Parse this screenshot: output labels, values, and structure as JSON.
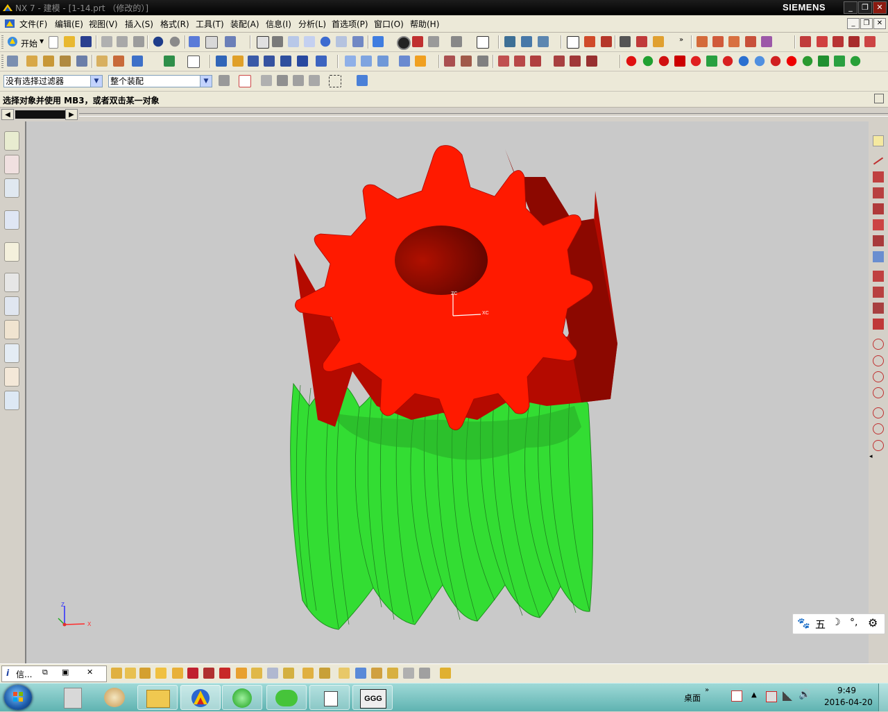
{
  "window": {
    "title": "NX 7 - 建模 - [1-14.prt （修改的）]",
    "brand": "SIEMENS",
    "controls": [
      "_",
      "❐",
      "✕"
    ]
  },
  "menu": {
    "items": [
      "文件(F)",
      "编辑(E)",
      "视图(V)",
      "插入(S)",
      "格式(R)",
      "工具(T)",
      "装配(A)",
      "信息(I)",
      "分析(L)",
      "首选项(P)",
      "窗口(O)",
      "帮助(H)"
    ]
  },
  "toolbar": {
    "start_label": "开始",
    "filter_value": "没有选择过滤器",
    "scope_value": "整个装配"
  },
  "cue_line": "选择对象并使用 MB3，或者双击某一对象",
  "viewport": {
    "wcs_z": "ZC",
    "wcs_x": "XC",
    "triad_z": "Z",
    "triad_x": "X",
    "gear_color": "#ff1a00",
    "worm_color": "#33dd33"
  },
  "ime": {
    "label": "五"
  },
  "info_window": {
    "label": "信..."
  },
  "tray": {
    "desktop": "桌面",
    "time": "9:49",
    "date": "2016-04-20"
  }
}
